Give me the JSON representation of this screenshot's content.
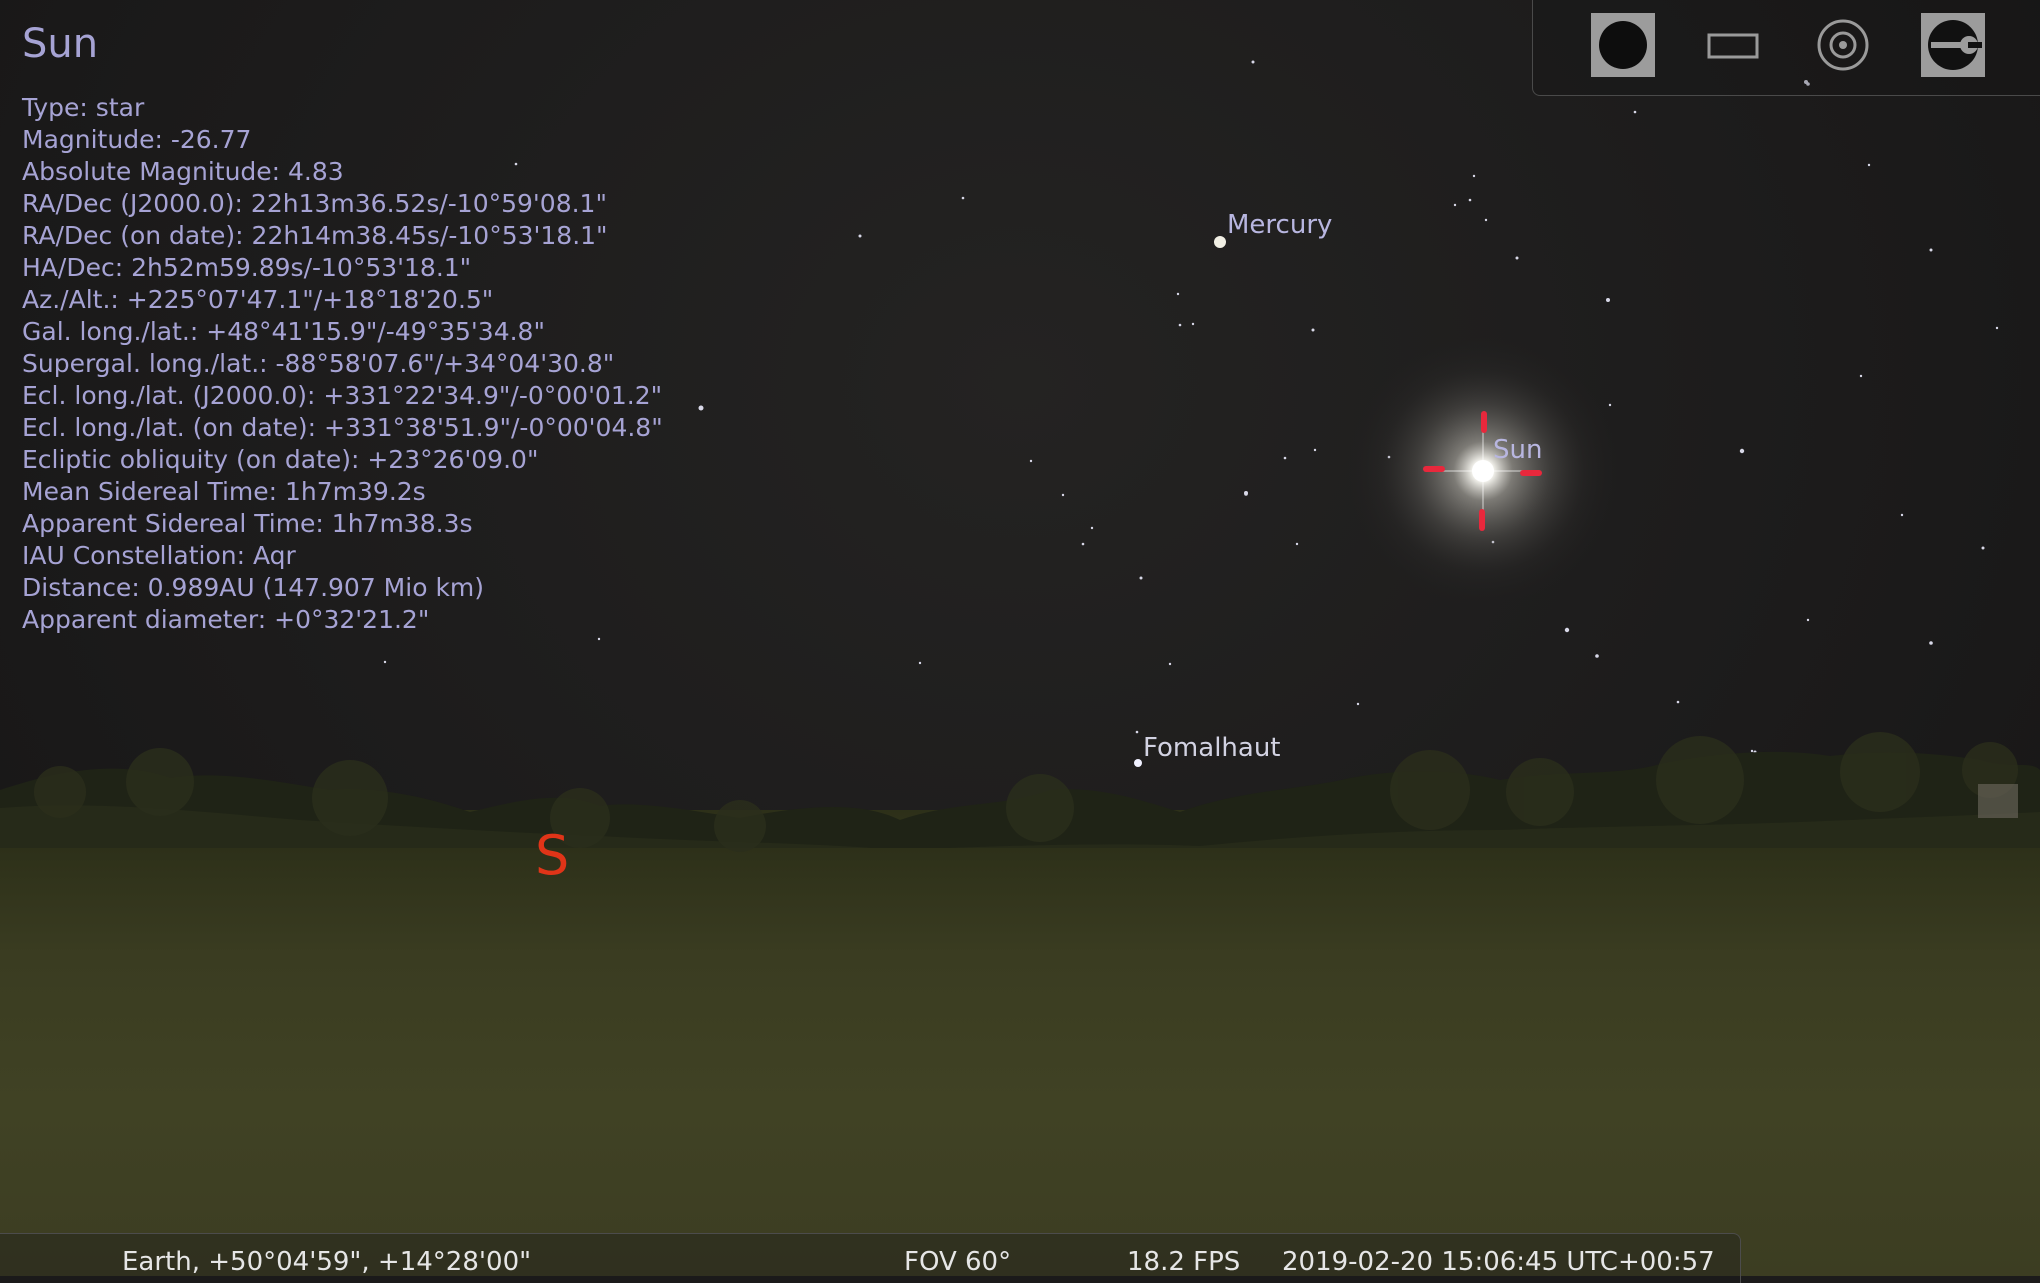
{
  "app": {
    "name": "Stellarium"
  },
  "selected_object": {
    "name": "Sun",
    "lines": [
      "Type: star",
      "Magnitude: -26.77",
      "Absolute Magnitude: 4.83",
      "RA/Dec (J2000.0): 22h13m36.52s/-10°59'08.1\"",
      "RA/Dec (on date): 22h14m38.45s/-10°53'18.1\"",
      "HA/Dec: 2h52m59.89s/-10°53'18.1\"",
      "Az./Alt.: +225°07'47.1\"/+18°18'20.5\"",
      "Gal. long./lat.: +48°41'15.9\"/-49°35'34.8\"",
      "Supergal. long./lat.: -88°58'07.6\"/+34°04'30.8\"",
      "Ecl. long./lat. (J2000.0): +331°22'34.9\"/-0°00'01.2\"",
      "Ecl. long./lat. (on date): +331°38'51.9\"/-0°00'04.8\"",
      "Ecliptic obliquity (on date): +23°26'09.0\"",
      "Mean Sidereal Time: 1h7m39.2s",
      "Apparent Sidereal Time: 1h7m38.3s",
      "IAU Constellation: Aqr",
      "Distance: 0.989AU (147.907 Mio km)",
      "Apparent diameter: +0°32'21.2\""
    ]
  },
  "sky_labels": {
    "mercury": "Mercury",
    "sun": "Sun",
    "fomalhaut": "Fomalhaut"
  },
  "cardinal": {
    "south": "S"
  },
  "toolbar": {
    "buttons": [
      {
        "icon": "planet-disk-icon",
        "active": true
      },
      {
        "icon": "rectangle-frame-icon",
        "active": false
      },
      {
        "icon": "target-circle-icon",
        "active": false
      },
      {
        "icon": "wrench-icon",
        "active": true
      }
    ]
  },
  "statusbar": {
    "location": "Earth, +50°04'59\", +14°28'00\"",
    "fov": "FOV 60°",
    "fps": "18.2 FPS",
    "datetime": "2019-02-20 15:06:45 UTC+00:57"
  },
  "colors": {
    "info_text": "#a6a3d4",
    "cardinal": "#e03418",
    "selection_marker": "#e8283c",
    "ground": "#3b3c22"
  }
}
